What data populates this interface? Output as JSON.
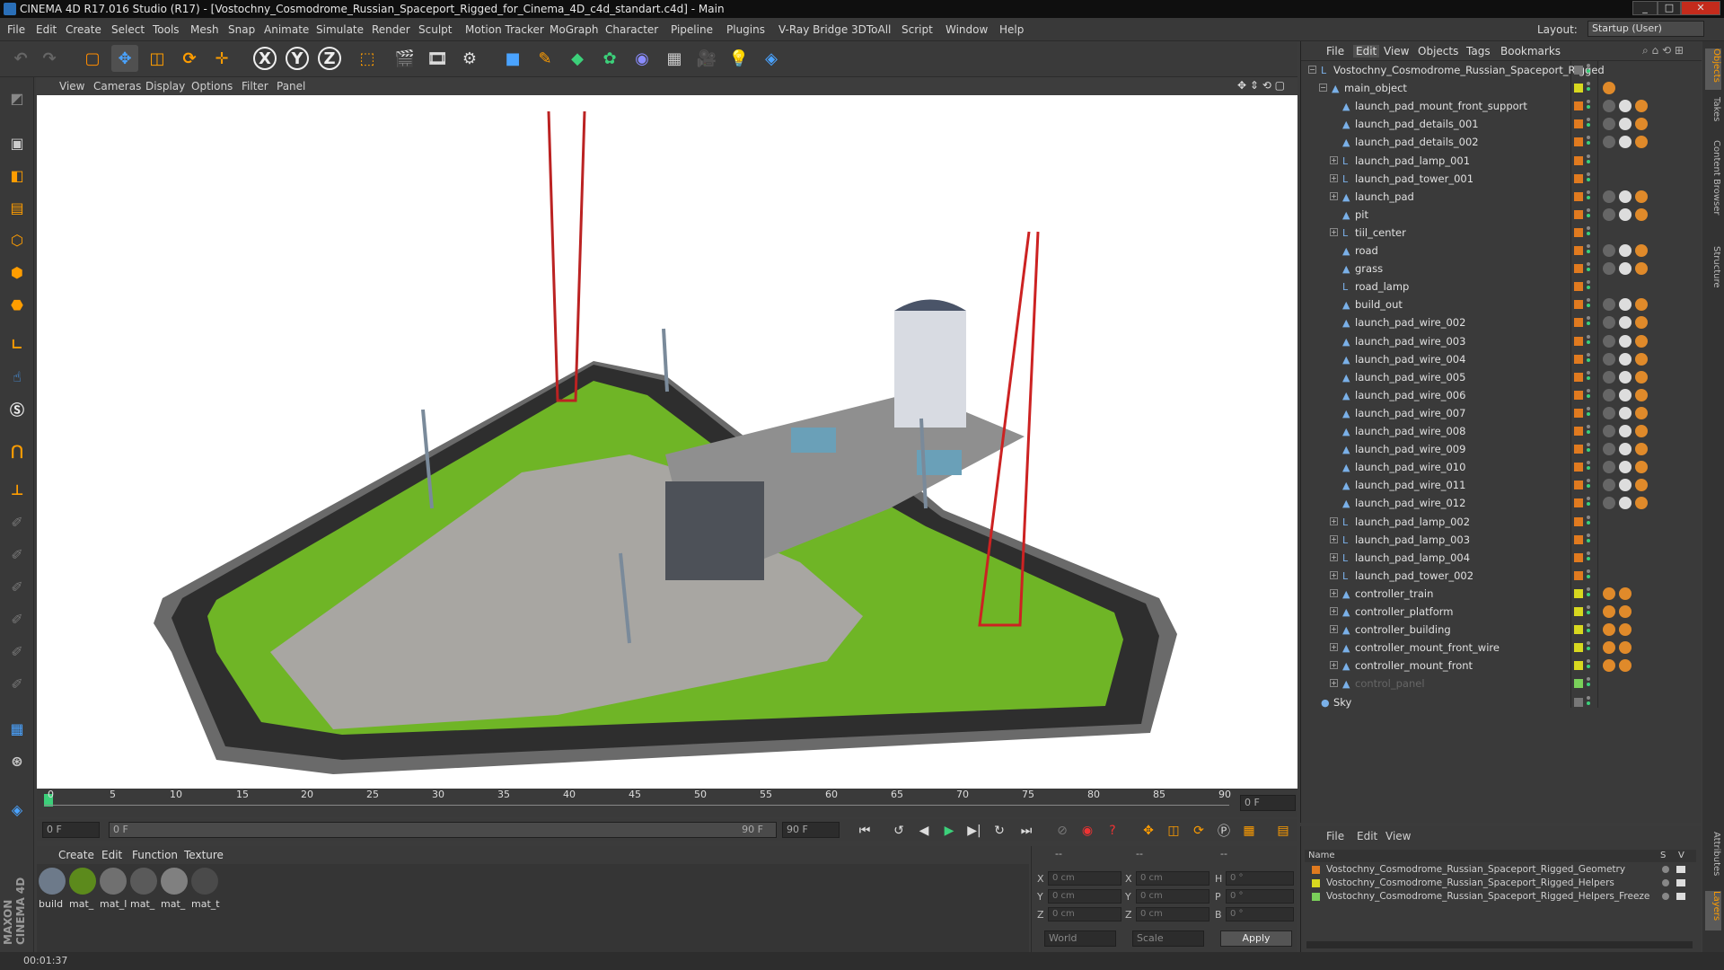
{
  "window": {
    "title": "CINEMA 4D R17.016 Studio (R17) - [Vostochny_Cosmodrome_Russian_Spaceport_Rigged_for_Cinema_4D_c4d_standart.c4d] - Main"
  },
  "menu": [
    "File",
    "Edit",
    "Create",
    "Select",
    "Tools",
    "Mesh",
    "Snap",
    "Animate",
    "Simulate",
    "Render",
    "Sculpt",
    "Motion Tracker",
    "MoGraph",
    "Character",
    "Pipeline",
    "Plugins",
    "V-Ray Bridge",
    "3DToAll",
    "Script",
    "Window",
    "Help"
  ],
  "layout": {
    "label": "Layout:",
    "value": "Startup (User)"
  },
  "toolbar": {
    "x": "X",
    "y": "Y",
    "z": "Z"
  },
  "viewport_menu": [
    "View",
    "Cameras",
    "Display",
    "Options",
    "Filter",
    "Panel"
  ],
  "timeline": {
    "ticks": [
      "0",
      "5",
      "10",
      "15",
      "20",
      "25",
      "30",
      "35",
      "40",
      "45",
      "50",
      "55",
      "60",
      "65",
      "70",
      "75",
      "80",
      "85",
      "90"
    ],
    "end_field": "0 F"
  },
  "range": {
    "start": "0 F",
    "slider_start": "0 F",
    "slider_end": "90 F",
    "end": "90 F"
  },
  "material_menu": [
    "Create",
    "Edit",
    "Function",
    "Texture"
  ],
  "materials": [
    {
      "label": "build",
      "color": "#6d7a8a"
    },
    {
      "label": "mat_",
      "color": "#5c8a1c"
    },
    {
      "label": "mat_l",
      "color": "#707070"
    },
    {
      "label": "mat_",
      "color": "#5a5a5a"
    },
    {
      "label": "mat_",
      "color": "#808080"
    },
    {
      "label": "mat_t",
      "color": "#4a4a4a"
    }
  ],
  "coords": {
    "header": [
      "--",
      "--",
      "--"
    ],
    "rows": [
      {
        "a": "X",
        "av": "0 cm",
        "b": "X",
        "bv": "0 cm",
        "c": "H",
        "cv": "0 °"
      },
      {
        "a": "Y",
        "av": "0 cm",
        "b": "Y",
        "bv": "0 cm",
        "c": "P",
        "cv": "0 °"
      },
      {
        "a": "Z",
        "av": "0 cm",
        "b": "Z",
        "bv": "0 cm",
        "c": "B",
        "cv": "0 °"
      }
    ],
    "mode": "World",
    "scale": "Scale",
    "apply": "Apply"
  },
  "status": {
    "time": "00:01:37"
  },
  "object_manager": {
    "menu": [
      "File",
      "Edit",
      "View",
      "Objects",
      "Tags",
      "Bookmarks"
    ],
    "root": "Vostochny_Cosmodrome_Russian_Spaceport_Rigged",
    "main": "main_object",
    "items": [
      "launch_pad_mount_front_support",
      "launch_pad_details_001",
      "launch_pad_details_002",
      "launch_pad_lamp_001",
      "launch_pad_tower_001",
      "launch_pad",
      "pit",
      "tiil_center",
      "road",
      "grass",
      "road_lamp",
      "build_out",
      "launch_pad_wire_002",
      "launch_pad_wire_003",
      "launch_pad_wire_004",
      "launch_pad_wire_005",
      "launch_pad_wire_006",
      "launch_pad_wire_007",
      "launch_pad_wire_008",
      "launch_pad_wire_009",
      "launch_pad_wire_010",
      "launch_pad_wire_011",
      "launch_pad_wire_012",
      "launch_pad_lamp_002",
      "launch_pad_lamp_003",
      "launch_pad_lamp_004",
      "launch_pad_tower_002",
      "controller_train",
      "controller_platform",
      "controller_building",
      "controller_mount_front_wire",
      "controller_mount_front",
      "control_panel"
    ],
    "sky": "Sky"
  },
  "layer_manager": {
    "menu": [
      "File",
      "Edit",
      "View"
    ],
    "header": {
      "name": "Name",
      "s": "S",
      "v": "V"
    },
    "layers": [
      {
        "name": "Vostochny_Cosmodrome_Russian_Spaceport_Rigged_Geometry",
        "color": "#e07a1f"
      },
      {
        "name": "Vostochny_Cosmodrome_Russian_Spaceport_Rigged_Helpers",
        "color": "#d8d81f"
      },
      {
        "name": "Vostochny_Cosmodrome_Russian_Spaceport_Rigged_Helpers_Freeze",
        "color": "#7ad05a"
      }
    ]
  },
  "side_tabs": [
    "Objects",
    "Takes",
    "Content Browser",
    "Structure",
    "Attributes",
    "Layers"
  ],
  "brand": "MAXON CINEMA 4D"
}
